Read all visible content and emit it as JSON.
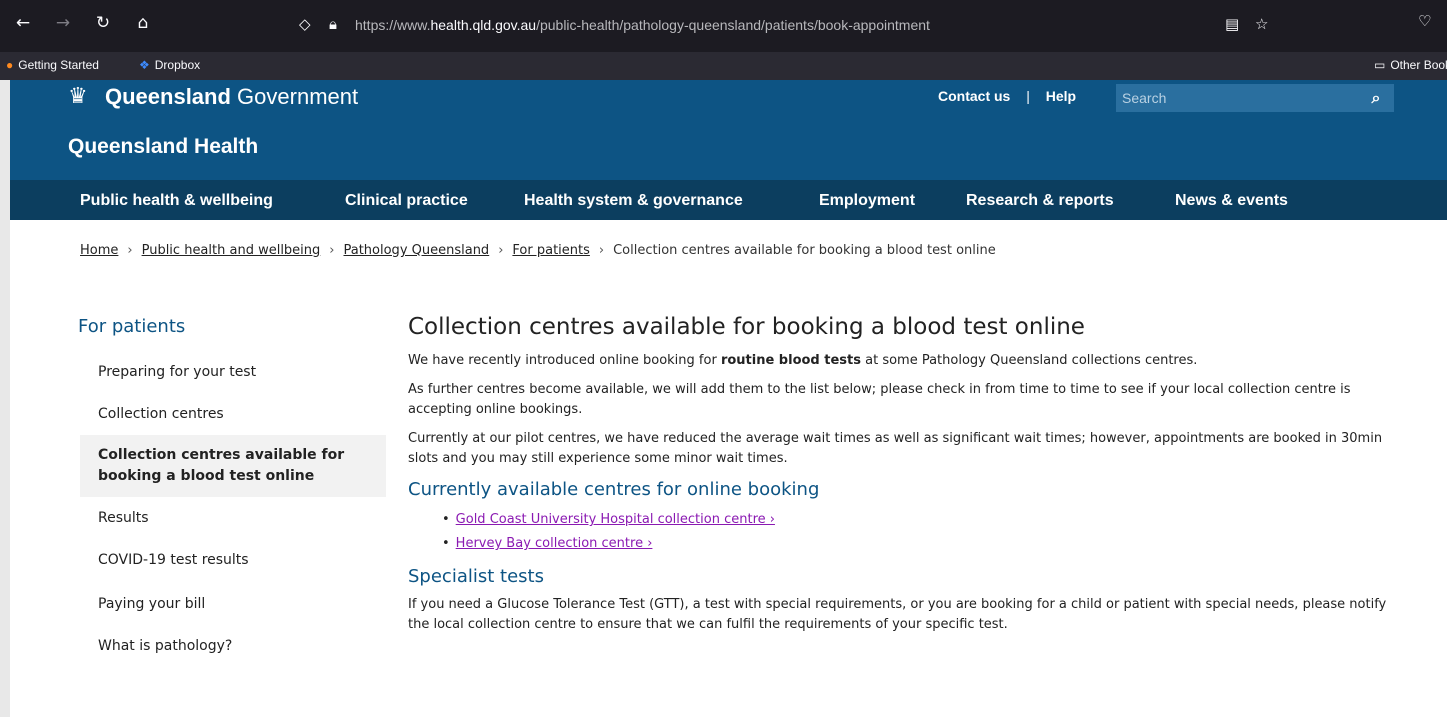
{
  "browser": {
    "url_prefix": "https://www.",
    "url_domain": "health.qld.gov.au",
    "url_path": "/public-health/pathology-queensland/patients/book-appointment",
    "bookmarks": [
      "Getting Started",
      "Dropbox"
    ],
    "other_bookmarks": "Other Bookr"
  },
  "header": {
    "gov_strong": "Queensland",
    "gov_rest": "Government",
    "site_title": "Queensland Health",
    "contact": "Contact us",
    "separator": "|",
    "help": "Help",
    "search_placeholder": "Search"
  },
  "nav": [
    "Public health & wellbeing",
    "Clinical practice",
    "Health system & governance",
    "Employment",
    "Research & reports",
    "News & events"
  ],
  "breadcrumb": [
    "Home",
    "Public health and wellbeing",
    "Pathology Queensland",
    "For patients",
    "Collection centres available for booking a blood test online"
  ],
  "sidebar": {
    "title": "For patients",
    "items": [
      "Preparing for your test",
      "Collection centres",
      "Collection centres available for booking a blood test online",
      "Results",
      "COVID-19 test results",
      "Paying your bill",
      "What is pathology?"
    ]
  },
  "main": {
    "title": "Collection centres available for booking a blood test online",
    "intro_before": "We have recently introduced online booking for ",
    "intro_bold": "routine blood tests",
    "intro_after": " at some Pathology Queensland collections centres.",
    "para2": "As further centres become available, we will add them to the list below; please check in from time to time to see if your local collection centre is accepting online bookings.",
    "para3": "Currently at our pilot centres, we have reduced the average wait times as well as significant wait times; however, appointments are booked in 30min slots and you may still experience some minor wait times.",
    "h2_available": "Currently available centres for online booking",
    "centres": [
      "Gold Coast University Hospital collection centre ›",
      "Hervey Bay collection centre ›"
    ],
    "h2_specialist": "Specialist tests",
    "specialist": "If you need a Glucose Tolerance Test (GTT), a test with special requirements, or you are booking for a child or patient with special needs, please notify the local collection centre to ensure that we can fulfil the requirements of your specific test."
  },
  "colors": {
    "header_blue": "#0d5484",
    "nav_dark": "#0c3e5f",
    "link_visited": "#8a19b2"
  },
  "icons": [
    "back-icon",
    "forward-icon",
    "reload-icon",
    "home-icon",
    "shield-icon",
    "lock-icon",
    "reader-icon",
    "star-icon",
    "pocket-icon",
    "search-icon",
    "folder-icon"
  ]
}
